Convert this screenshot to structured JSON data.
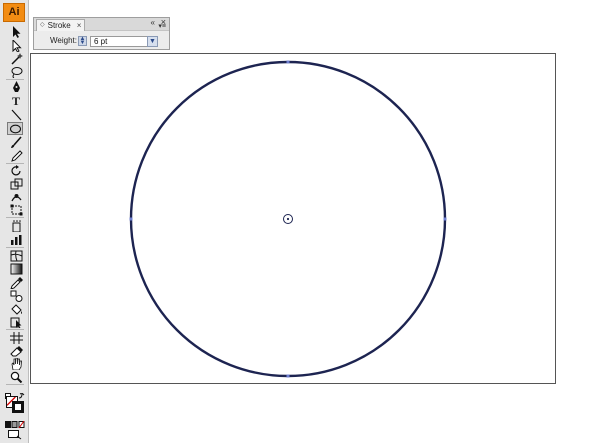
{
  "app": {
    "logo": "Ai"
  },
  "stroke_panel": {
    "tab_label": "Stroke",
    "tab_grip": "◇",
    "tab_close": "×",
    "collapse_glyph": "«",
    "close_glyph": "×",
    "menu_glyph": "▾≡",
    "weight_label": "Weight:",
    "weight_value": "6 pt"
  },
  "canvas": {
    "shape": "circle",
    "stroke_color": "#1d2451",
    "stroke_weight_pt": 6,
    "center_marker": "circle-center-point"
  },
  "colors": {
    "logo_bg": "#f28c13",
    "panel_bg": "#ececec",
    "toolbar_bg": "#e6e6e6"
  },
  "tools": [
    "selection-tool-icon",
    "direct-selection-tool-icon",
    "magic-wand-tool-icon",
    "lasso-tool-icon",
    "pen-tool-icon",
    "type-tool-icon",
    "line-segment-tool-icon",
    "ellipse-tool-icon",
    "paintbrush-tool-icon",
    "pencil-tool-icon",
    "rotate-tool-icon",
    "scale-tool-icon",
    "warp-tool-icon",
    "free-transform-tool-icon",
    "symbol-sprayer-tool-icon",
    "column-graph-tool-icon",
    "mesh-tool-icon",
    "gradient-tool-icon",
    "eyedropper-tool-icon",
    "blend-tool-icon",
    "live-paint-bucket-tool-icon",
    "live-paint-selection-tool-icon",
    "slice-tool-icon",
    "eraser-tool-icon",
    "hand-tool-icon",
    "zoom-tool-icon"
  ]
}
